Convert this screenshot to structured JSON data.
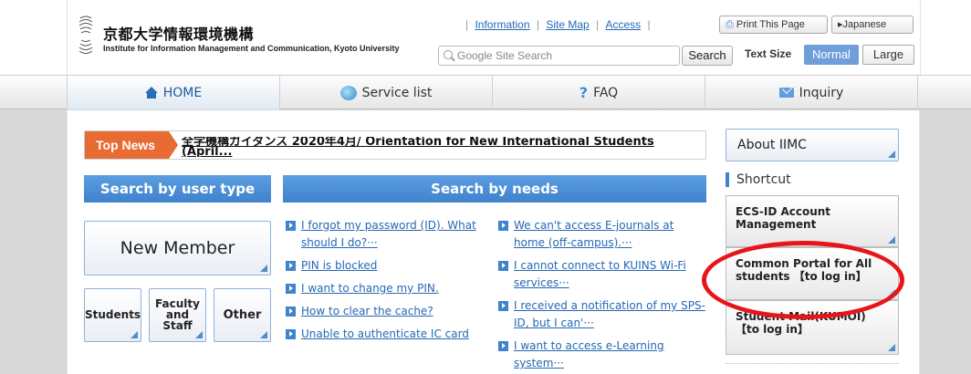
{
  "header": {
    "title_jp": "京都大学情報環境機構",
    "title_en": "Institute for Information Management and Communication, Kyoto University",
    "links": [
      "Information",
      "Site Map",
      "Access"
    ],
    "print_label": "Print This Page",
    "japanese_label": "▸Japanese",
    "search_placeholder": "Google Site Search",
    "search_button": "Search",
    "text_size_label": "Text Size",
    "size_normal": "Normal",
    "size_large": "Large"
  },
  "nav": {
    "home": "HOME",
    "service": "Service list",
    "faq": "FAQ",
    "inquiry": "Inquiry"
  },
  "topnews": {
    "tag": "Top News",
    "text": "全学機構ガイダンス 2020年4月/ Orientation for New International Students (April..."
  },
  "user_type": {
    "heading": "Search by user type",
    "new_member": "New Member",
    "students": "Students",
    "faculty": "Faculty and Staff",
    "other": "Other"
  },
  "needs": {
    "heading": "Search by needs",
    "col1": [
      "I forgot my password (ID). What should I do?···",
      "PIN is blocked",
      "I want to change my PIN.",
      "How to clear the cache?",
      "Unable to authenticate IC card"
    ],
    "col2": [
      "We can't access E-journals at home (off-campus).···",
      "I cannot connect to KUINS Wi-Fi services···",
      "I received a notification of my SPS-ID, but I can'···",
      "I want to access e-Learning system···"
    ]
  },
  "right": {
    "about": "About IIMC",
    "shortcut": "Shortcut",
    "ecs": "ECS-ID Account Management",
    "portal": "Common Portal for All students 【to log in】",
    "mail": "Student Mail(KUMOI) 【to log in】"
  },
  "colors": {
    "accent_blue": "#3f83cc",
    "top_news_orange": "#e86b33",
    "highlight_red": "#e8141b",
    "size_normal_bg": "#6f9ed9"
  }
}
